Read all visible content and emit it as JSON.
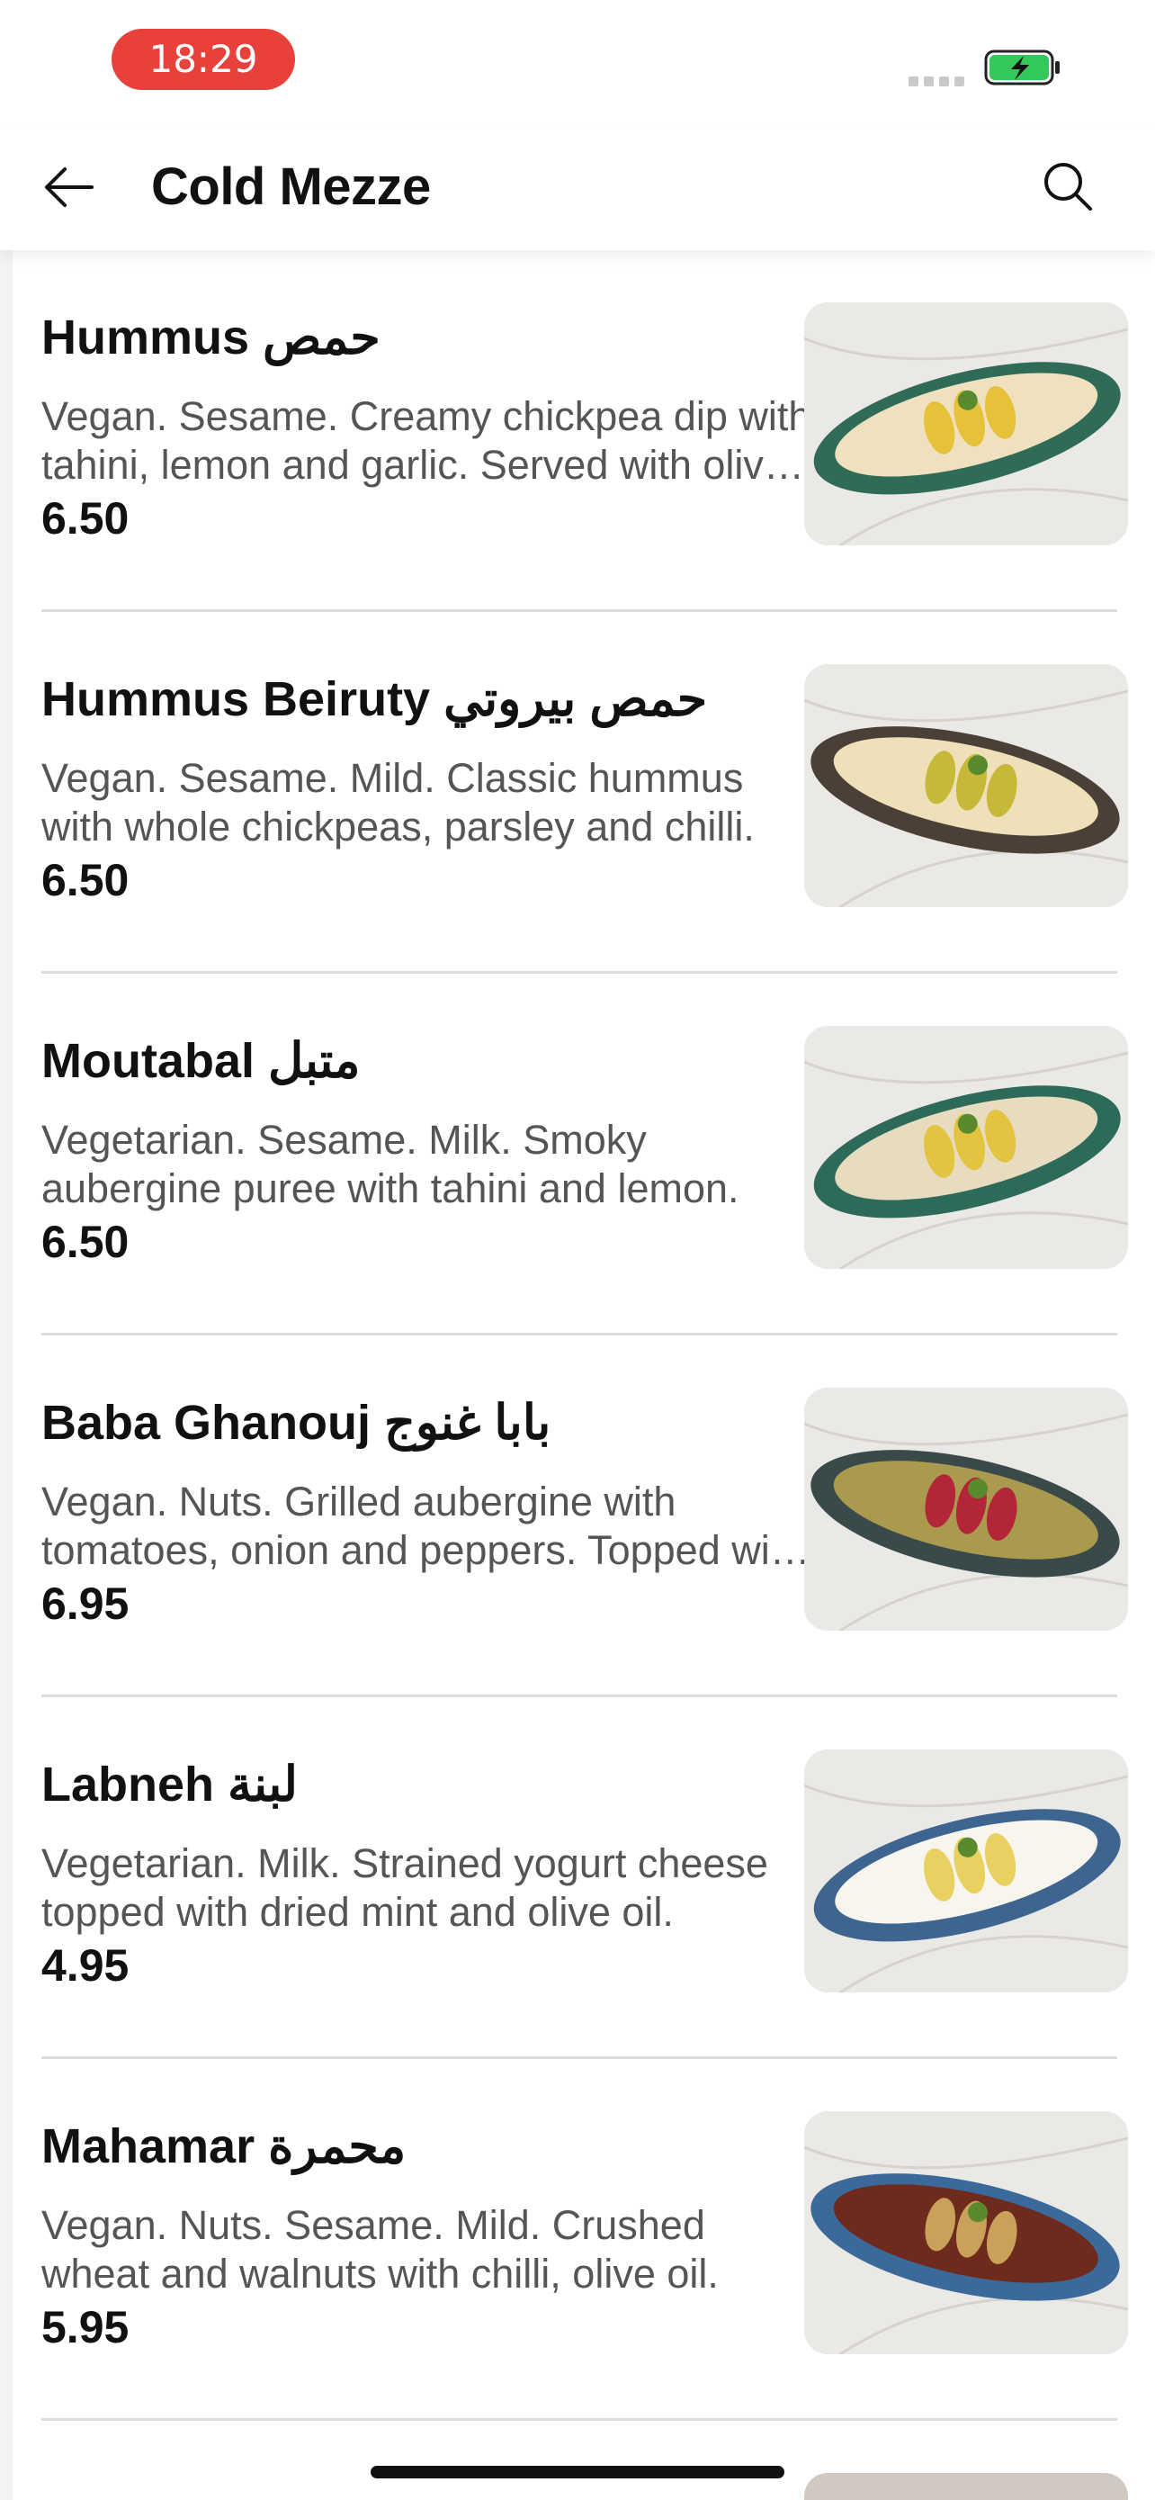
{
  "status_bar": {
    "time": "18:29",
    "battery_icon": "battery-charging-icon",
    "accent": "#e8403a",
    "battery_color": "#34c759"
  },
  "header": {
    "title": "Cold Mezze",
    "back_icon": "arrow-left-icon",
    "search_icon": "search-icon"
  },
  "items": [
    {
      "name": "Hummus حمص",
      "description": "Vegan. Sesame. Creamy chickpea dip with tahini, lemon and garlic. Served with olive oil.",
      "price": "6.50",
      "plate_color": "#2f6b57",
      "dip_color": "#efe0bf",
      "topping_color": "#e6c23a"
    },
    {
      "name": "Hummus Beiruty حمص بيروتي",
      "description": "Vegan. Sesame. Mild. Classic hummus with whole chickpeas, parsley and chilli.",
      "price": "6.50",
      "plate_color": "#4a4038",
      "dip_color": "#eee0b8",
      "topping_color": "#c8b83a"
    },
    {
      "name": "Moutabal متبل",
      "description": "Vegetarian. Sesame. Milk. Smoky aubergine puree with tahini and lemon.",
      "price": "6.50",
      "plate_color": "#2e6a5a",
      "dip_color": "#e8dcc0",
      "topping_color": "#e3c440"
    },
    {
      "name": "Baba Ghanouj بابا غنوج",
      "description": "Vegan. Nuts. Grilled aubergine with tomatoes, onion and peppers. Topped with walnuts.",
      "price": "6.95",
      "plate_color": "#3a4a4a",
      "dip_color": "#a99a4e",
      "topping_color": "#b3263a"
    },
    {
      "name": "Labneh لبنة",
      "description": "Vegetarian. Milk. Strained yogurt cheese topped with dried mint and olive oil.",
      "price": "4.95",
      "plate_color": "#3e6590",
      "dip_color": "#f7f5ee",
      "topping_color": "#e8d160"
    },
    {
      "name": "Mahamar محمرة",
      "description": "Vegan. Nuts. Sesame. Mild. Crushed wheat and walnuts with chilli, olive oil.",
      "price": "5.95",
      "plate_color": "#3b6a9a",
      "dip_color": "#6e2a1c",
      "topping_color": "#c9a15a"
    }
  ]
}
